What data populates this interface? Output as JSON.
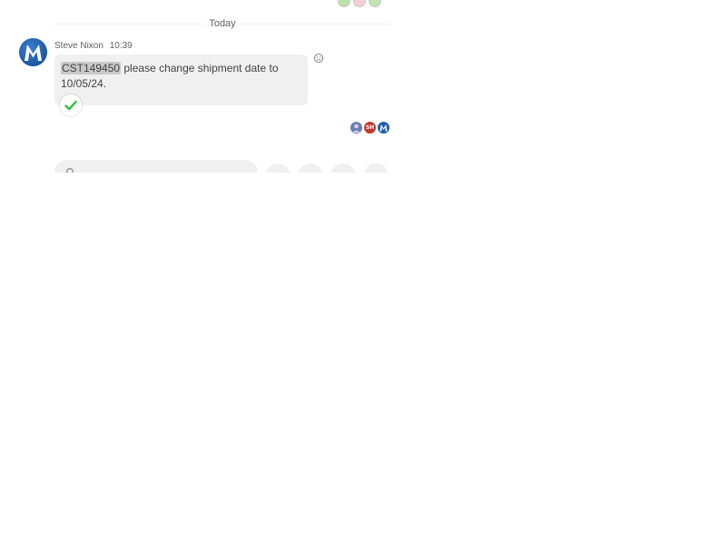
{
  "date_separator": "Today",
  "message": {
    "sender": "Steve Nixon",
    "time": "10:39",
    "reference": "CST149450",
    "text": " please change shipment date to 10/05/24."
  },
  "icons": {
    "avatar": "company-logo-avatar",
    "status": "checkmark-icon",
    "reaction": "smiley-icon"
  },
  "readers": [
    {
      "name": "reader-1",
      "initials": ""
    },
    {
      "name": "reader-2",
      "initials": "SH"
    },
    {
      "name": "reader-3",
      "initials": ""
    }
  ],
  "colors": {
    "bubble": "#f0f0f0",
    "highlight": "#c9c9c9",
    "check": "#2fbf3a",
    "avatar": "#1f5ea8"
  }
}
